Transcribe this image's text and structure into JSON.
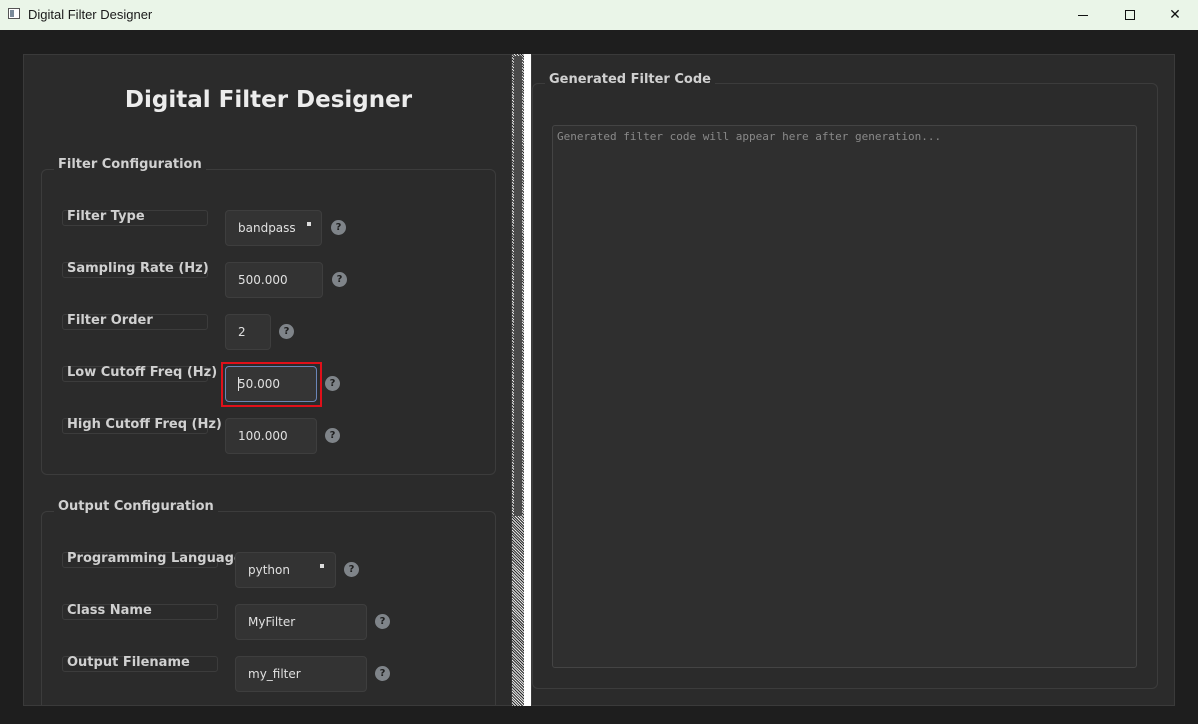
{
  "window": {
    "title": "Digital Filter Designer"
  },
  "left": {
    "title": "Digital Filter Designer",
    "filter_group": {
      "title": "Filter Configuration",
      "rows": [
        {
          "label": "Filter Type",
          "value": "bandpass",
          "kind": "combo"
        },
        {
          "label": "Sampling Rate (Hz)",
          "value": "500.000",
          "kind": "spin"
        },
        {
          "label": "Filter Order",
          "value": "2",
          "kind": "spin"
        },
        {
          "label": "Low Cutoff Freq (Hz)",
          "value": "50.000",
          "kind": "spin",
          "focused": true
        },
        {
          "label": "High Cutoff Freq (Hz)",
          "value": "100.000",
          "kind": "spin"
        }
      ]
    },
    "output_group": {
      "title": "Output Configuration",
      "rows": [
        {
          "label": "Programming Language",
          "value": "python",
          "kind": "combo"
        },
        {
          "label": "Class Name",
          "value": "MyFilter",
          "kind": "text"
        },
        {
          "label": "Output Filename",
          "value": "my_filter",
          "kind": "text"
        }
      ]
    },
    "help_glyph": "?"
  },
  "right": {
    "group_title": "Generated Filter Code",
    "placeholder": "Generated filter code will appear here after generation..."
  },
  "colors": {
    "highlight": "#e0101a",
    "background": "#2b2b2b"
  }
}
